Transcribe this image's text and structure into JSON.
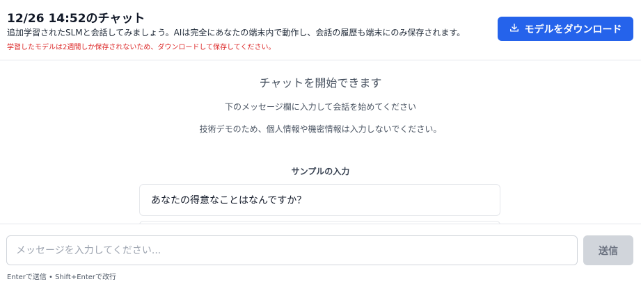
{
  "header": {
    "title": "12/26 14:52のチャット",
    "description": "追加学習されたSLMと会話してみましょう。AIは完全にあなたの端末内で動作し、会話の履歴も端末にのみ保存されます。",
    "warning": "学習したモデルは2週間しか保存されないため、ダウンロードして保存してください。",
    "download_label": "モデルをダウンロード",
    "download_icon": "download-icon"
  },
  "empty_state": {
    "title": "チャットを開始できます",
    "line1": "下のメッセージ欄に入力して会話を始めてください",
    "line2": "技術デモのため、個人情報や機密情報は入力しないでください。"
  },
  "samples": {
    "heading": "サンプルの入力",
    "items": [
      {
        "text": "あなたの得意なことはなんですか？"
      },
      {
        "text": ""
      }
    ]
  },
  "composer": {
    "placeholder": "メッセージを入力してください...",
    "value": "",
    "send_label": "送信",
    "hint": "Enterで送信 • Shift+Enterで改行"
  },
  "colors": {
    "primary": "#2563eb",
    "warning": "#dc2626",
    "send_disabled": "#d1d5db"
  }
}
